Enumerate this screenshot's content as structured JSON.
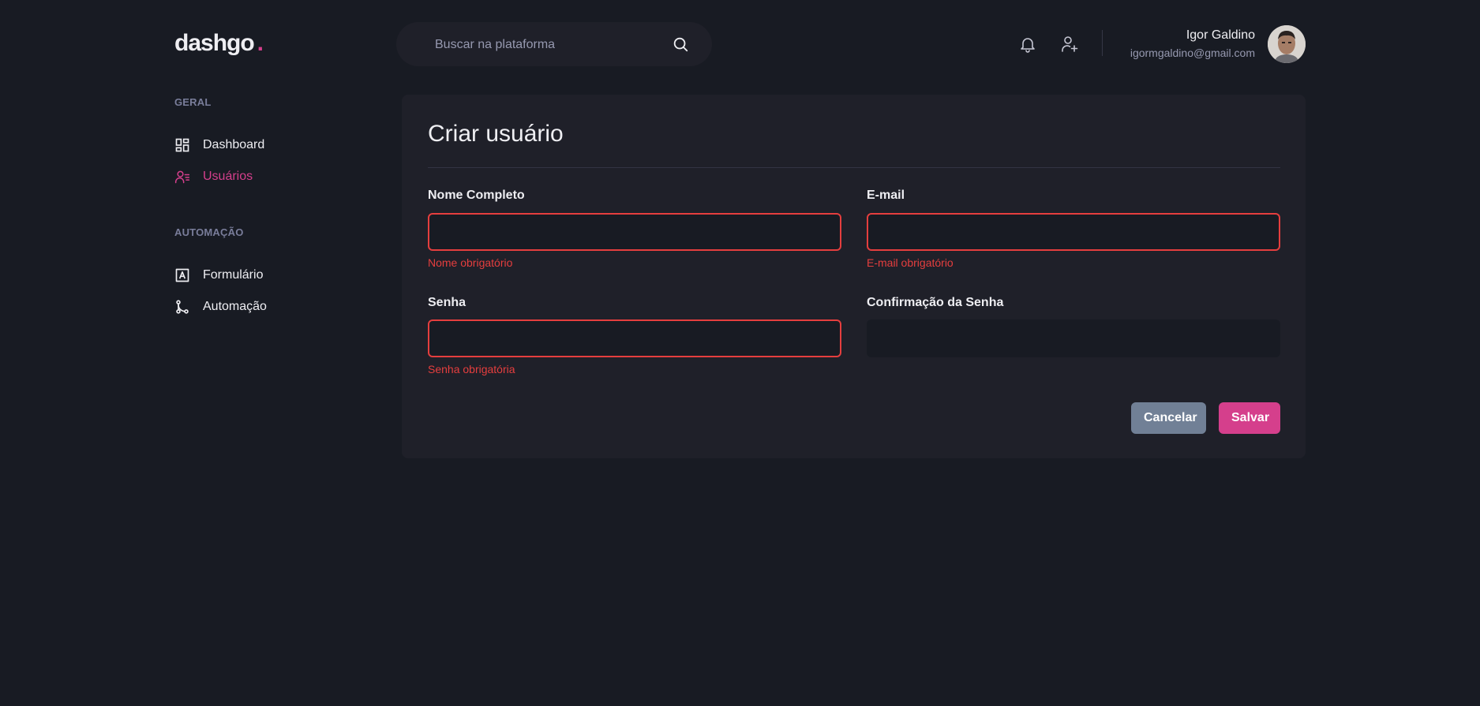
{
  "header": {
    "logo": "dashgo",
    "logo_dot": ".",
    "search_placeholder": "Buscar na plataforma",
    "user": {
      "name": "Igor Galdino",
      "email": "igormgaldino@gmail.com"
    },
    "icons": [
      "search-icon",
      "bell-icon",
      "user-plus-icon"
    ]
  },
  "sidebar": {
    "sections": [
      {
        "title": "GERAL",
        "items": [
          {
            "label": "Dashboard",
            "icon": "dashboard-icon",
            "active": false
          },
          {
            "label": "Usuários",
            "icon": "users-icon",
            "active": true
          }
        ]
      },
      {
        "title": "AUTOMAÇÃO",
        "items": [
          {
            "label": "Formulário",
            "icon": "form-icon",
            "active": false
          },
          {
            "label": "Automação",
            "icon": "git-merge-icon",
            "active": false
          }
        ]
      }
    ]
  },
  "form": {
    "title": "Criar usuário",
    "fields": {
      "name": {
        "label": "Nome Completo",
        "value": "",
        "error": "Nome obrigatório"
      },
      "email": {
        "label": "E-mail",
        "value": "",
        "error": "E-mail obrigatório"
      },
      "password": {
        "label": "Senha",
        "value": "",
        "error": "Senha obrigatória"
      },
      "password_confirmation": {
        "label": "Confirmação da Senha",
        "value": "",
        "error": ""
      }
    },
    "cancel_label": "Cancelar",
    "save_label": "Salvar"
  },
  "colors": {
    "background": "#181b23",
    "card": "#1f2029",
    "accent": "#d53f8c",
    "error": "#e53e3e",
    "muted": "#9699b0",
    "cancel_button": "#718096"
  }
}
